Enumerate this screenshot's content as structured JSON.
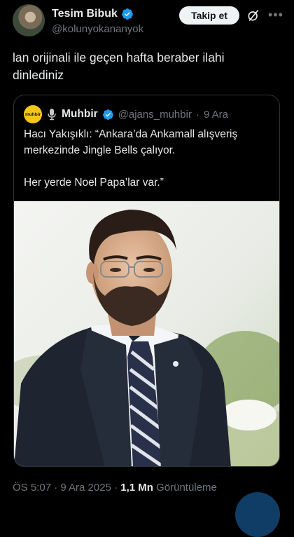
{
  "author": {
    "name": "Tesim Bibuk",
    "handle": "@kolunyokananyok",
    "follow_label": "Takip et"
  },
  "tweet": {
    "text": "lan orijinali ile geçen hafta beraber ilahi dinlediniz"
  },
  "quote": {
    "logo_text": "muhbir",
    "name": "Muhbir",
    "handle": "@ajans_muhbir",
    "separator": "·",
    "date": "9 Ara",
    "paragraph1": "Hacı Yakışıklı: “Ankara’da Ankamall alışveriş merkezinde Jingle Bells çalıyor.",
    "paragraph2": "Her yerde Noel Papa’lar var.”"
  },
  "footer": {
    "time_date": "ÖS 5:07 · 9 Ara 2025 · ",
    "views_count": "1,1 Mn",
    "views_label": " Görüntüleme"
  },
  "colors": {
    "background": "#000000",
    "verified_blue": "#1d9bf0",
    "muted_text": "#71767b"
  }
}
